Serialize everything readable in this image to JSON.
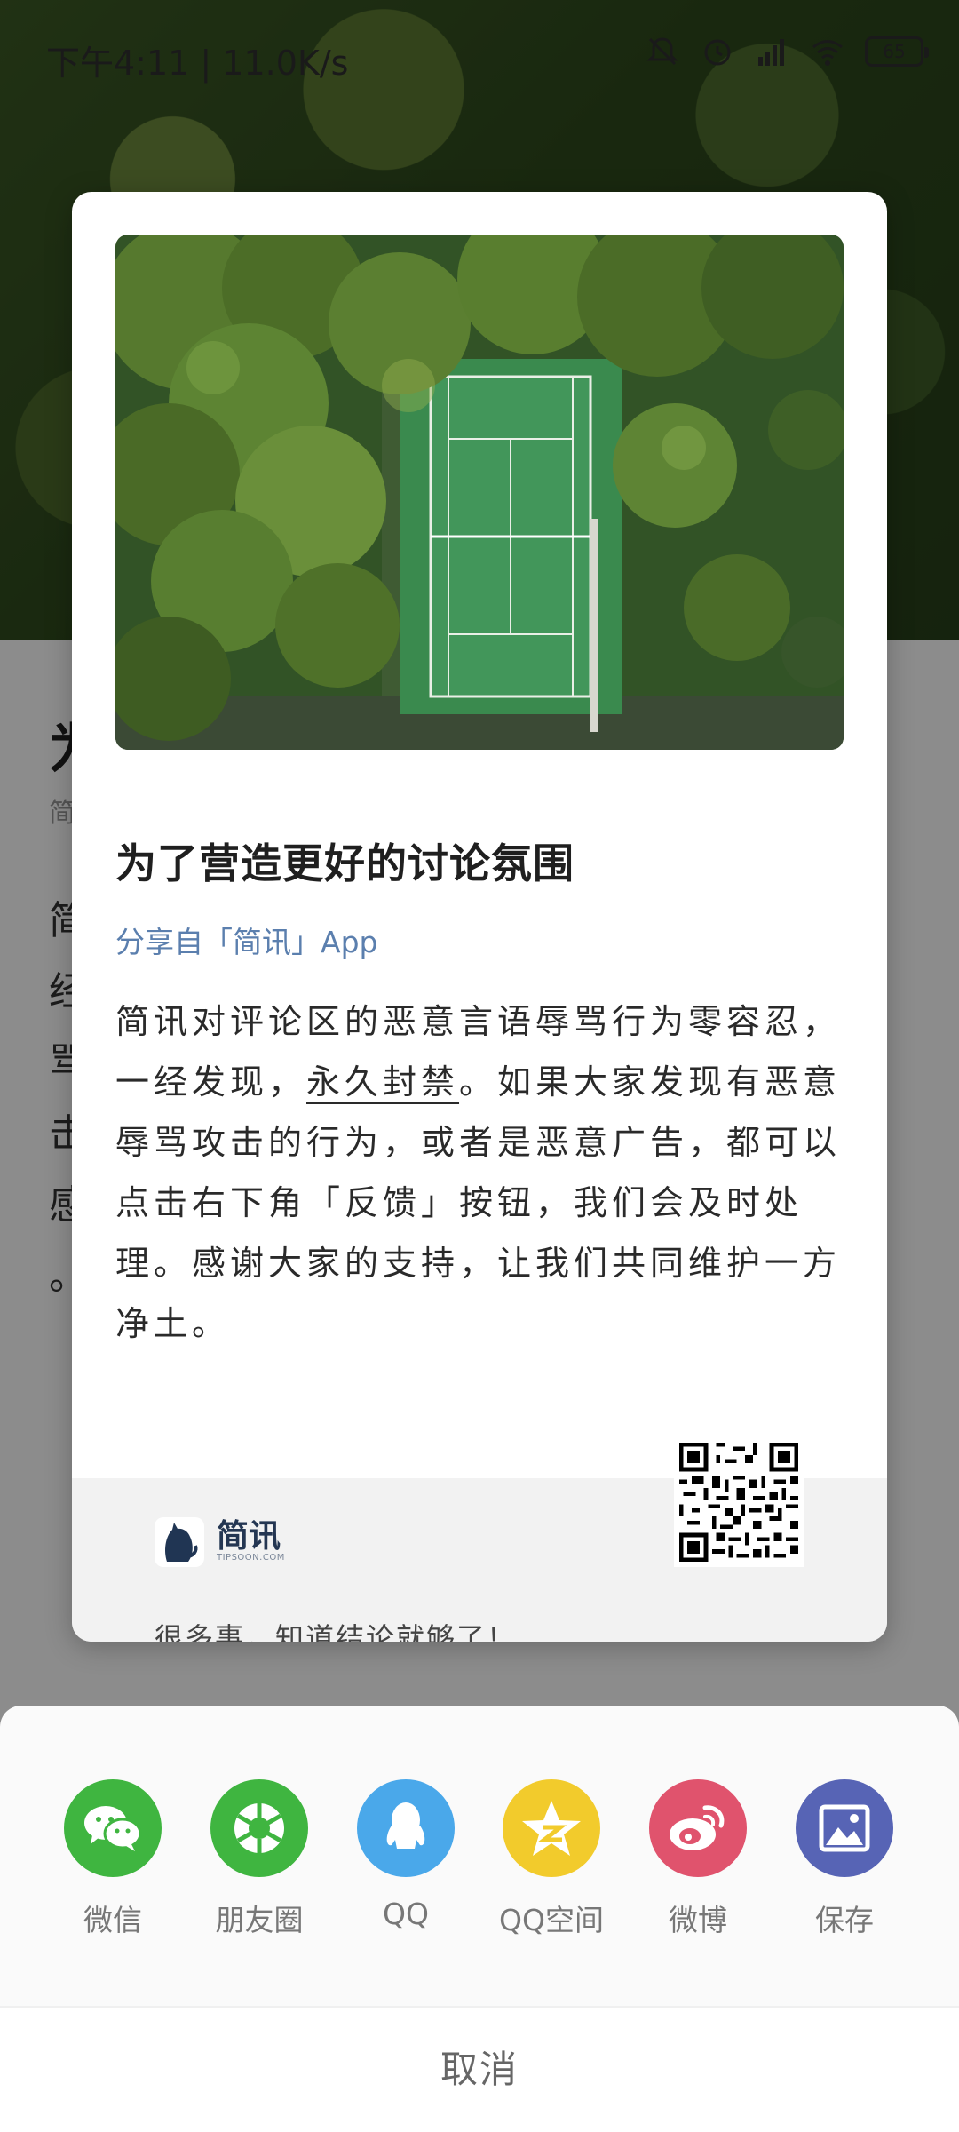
{
  "status_bar": {
    "time": "下午4:11 | 11.0K/s",
    "battery": "65"
  },
  "background_article": {
    "title": "为",
    "meta": "简",
    "lines": [
      "简",
      "经",
      "骂",
      "击",
      "感",
      "。"
    ]
  },
  "share_card": {
    "title": "为了营造更好的讨论氛围",
    "source": "分享自「简讯」App",
    "body_part1": "简讯对评论区的恶意言语辱骂行为零容忍，一经发现，",
    "body_emph": "永久封禁",
    "body_part2": "。如果大家发现有恶意辱骂攻击的行为，或者是恶意广告，都可以点击右下角「反馈」按钮，我们会及时处理。感谢大家的支持，让我们共同维护一方净土。",
    "brand_name": "简讯",
    "brand_domain": "TIPSOON.COM",
    "slogan": "很多事，知道结论就够了！"
  },
  "share_sheet": {
    "items": [
      {
        "label": "微信",
        "icon": "wechat-icon",
        "color": "#3fb540"
      },
      {
        "label": "朋友圈",
        "icon": "moments-icon",
        "color": "#3fb540"
      },
      {
        "label": "QQ",
        "icon": "qq-icon",
        "color": "#4aa8ea"
      },
      {
        "label": "QQ空间",
        "icon": "qzone-icon",
        "color": "#f2cb2c"
      },
      {
        "label": "微博",
        "icon": "weibo-icon",
        "color": "#e0536d"
      },
      {
        "label": "保存",
        "icon": "save-image-icon",
        "color": "#5764b5"
      }
    ],
    "cancel": "取消"
  }
}
